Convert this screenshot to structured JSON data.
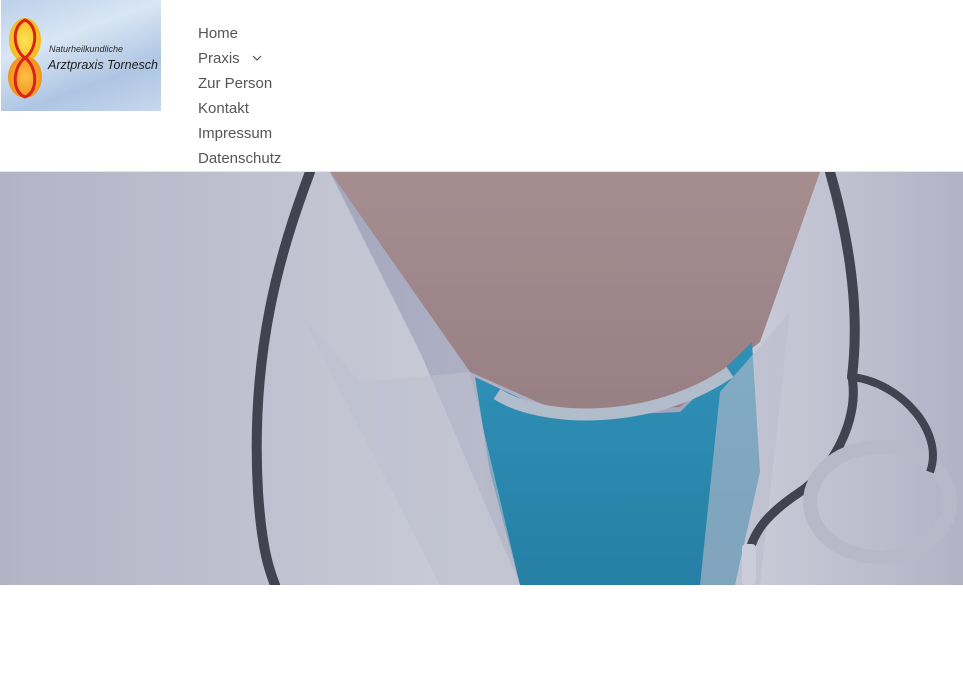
{
  "header": {
    "logo": {
      "line1": "Naturheilkundliche",
      "line2": "Arztpraxis Tornesch"
    },
    "nav": {
      "home": "Home",
      "praxis": "Praxis",
      "zur_person": "Zur Person",
      "kontakt": "Kontakt",
      "impressum": "Impressum",
      "datenschutz": "Datenschutz"
    }
  },
  "icons": {
    "praxis_dropdown": "chevron-down-icon"
  },
  "colors": {
    "nav_text": "#555555",
    "scrubs": "#2a9fc4",
    "coat": "#e6e6ea",
    "hero_tint": "#505482"
  }
}
